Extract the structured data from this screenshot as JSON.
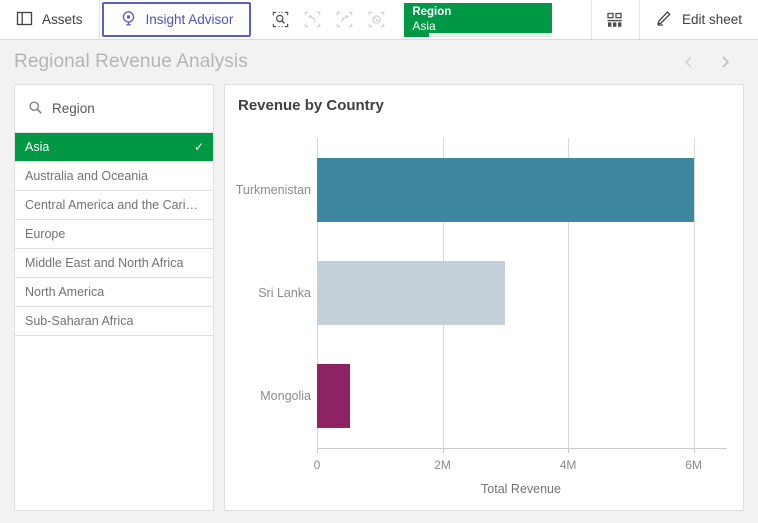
{
  "toolbar": {
    "assets_label": "Assets",
    "assets_icon": "panel-left-icon",
    "insight_advisor_label": "Insight Advisor",
    "insight_advisor_icon": "insight-bulb-icon",
    "selection_tools": [
      {
        "name": "selections-tool-icon",
        "label": "Selections tool",
        "disabled": false
      },
      {
        "name": "step-back-icon",
        "label": "Step back",
        "disabled": true
      },
      {
        "name": "step-forward-icon",
        "label": "Step forward",
        "disabled": true
      },
      {
        "name": "clear-selections-icon",
        "label": "Clear all selections",
        "disabled": true
      }
    ],
    "selection_chip": {
      "field": "Region",
      "value": "Asia",
      "meter_percent": 17,
      "color": "#009845"
    },
    "sheet_icon": "sheet-grid-icon",
    "edit_label": "Edit sheet",
    "edit_icon": "pencil-icon",
    "active_tab_color": "#5a5fc7"
  },
  "sheet": {
    "title": "Regional Revenue Analysis",
    "prev_label": "Previous sheet",
    "next_label": "Next sheet",
    "prev_icon": "chevron-left-icon",
    "next_icon": "chevron-right-icon"
  },
  "filter_pane": {
    "search_icon": "search-icon",
    "field_label": "Region",
    "search_placeholder": "Region",
    "items": [
      {
        "label": "Asia",
        "selected": true
      },
      {
        "label": "Australia and Oceania",
        "selected": false
      },
      {
        "label": "Central America and the Carib…",
        "selected": false
      },
      {
        "label": "Europe",
        "selected": false
      },
      {
        "label": "Middle East and North Africa",
        "selected": false
      },
      {
        "label": "North America",
        "selected": false
      },
      {
        "label": "Sub-Saharan Africa",
        "selected": false
      }
    ],
    "selected_color": "#009845",
    "check_glyph": "✓"
  },
  "chart_data": {
    "type": "bar",
    "orientation": "horizontal",
    "title": "Revenue by Country",
    "categories": [
      "Turkmenistan",
      "Sri Lanka",
      "Mongolia"
    ],
    "values": [
      6000000,
      3000000,
      520000
    ],
    "colors": [
      "#3d87a0",
      "#c5cfda",
      "#8e2364"
    ],
    "xlabel": "Total Revenue",
    "ylabel": "",
    "xlim": [
      0,
      6500000
    ],
    "xticks": [
      0,
      2000000,
      4000000,
      6000000
    ],
    "xtick_labels": [
      "0",
      "2M",
      "4M",
      "6M"
    ],
    "grid": true,
    "legend": false
  }
}
